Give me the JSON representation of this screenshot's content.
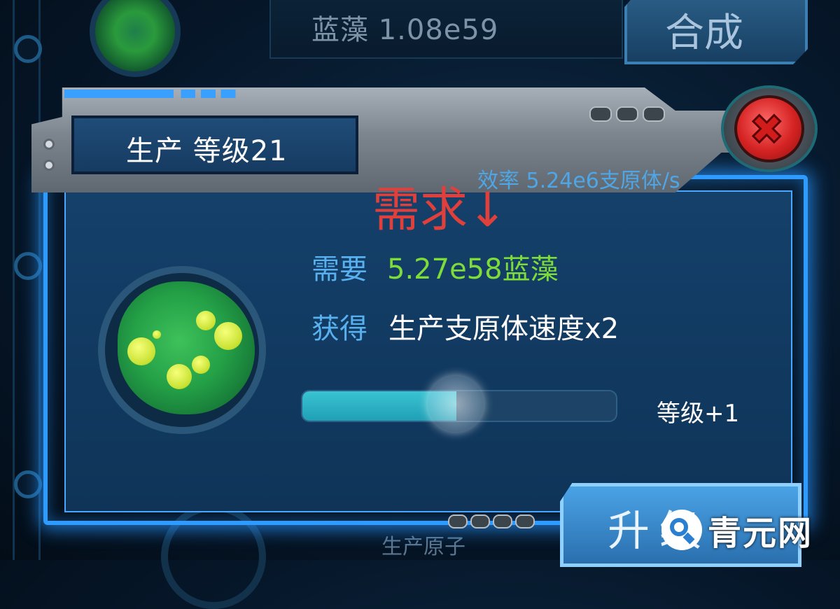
{
  "background": {
    "resource_label": "蓝藻 1.08e59",
    "synthesize_label": "合成",
    "ghost_text": "生产原子"
  },
  "dialog": {
    "title": "生产 等级21",
    "efficiency": "效率 5.24e6支原体/s",
    "annotation": "需求↓",
    "requirement": {
      "label": "需要",
      "value": "5.27e58蓝藻"
    },
    "reward": {
      "label": "获得",
      "value": "生产支原体速度x2"
    },
    "progress": {
      "fraction": 0.49,
      "level_gain": "等级+1"
    },
    "upgrade_label": "升级",
    "close_icon": "close-icon"
  },
  "watermark": {
    "text": "青元网",
    "logo_icon": "search-logo-icon"
  },
  "colors": {
    "panel": "#14406a",
    "glow": "#2f9bff",
    "requirement_value": "#7edc3a",
    "label_blue": "#58b0ef",
    "annotation_red": "#e0403b",
    "progress_fill": "#39c3d3",
    "close_red": "#d52323"
  }
}
